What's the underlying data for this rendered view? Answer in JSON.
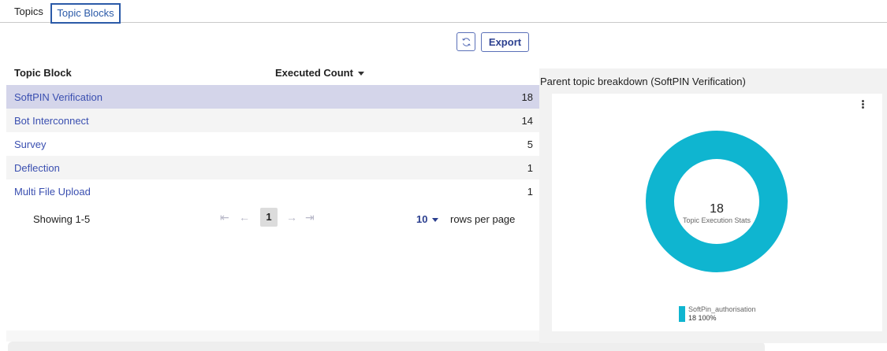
{
  "tabs": [
    {
      "label": "Topics"
    },
    {
      "label": "Topic Blocks"
    }
  ],
  "toolbar": {
    "refresh_icon": "refresh-icon",
    "export_label": "Export"
  },
  "table": {
    "columns": [
      "Topic Block",
      "Executed Count"
    ],
    "sort_column": "Executed Count",
    "rows": [
      {
        "name": "SoftPIN Verification",
        "count": "18"
      },
      {
        "name": "Bot Interconnect",
        "count": "14"
      },
      {
        "name": "Survey",
        "count": "5"
      },
      {
        "name": "Deflection",
        "count": "1"
      },
      {
        "name": "Multi File Upload",
        "count": "1"
      }
    ]
  },
  "pagination": {
    "showing": "Showing 1-5",
    "page": "1",
    "first_glyph": "⇤",
    "prev_glyph": "←",
    "next_glyph": "→",
    "last_glyph": "⇥",
    "rows_per_page_value": "10",
    "rows_per_page_label": "rows per page"
  },
  "panel": {
    "title": "Parent topic breakdown (SoftPIN Verification)",
    "center_value": "18",
    "center_label": "Topic Execution Stats",
    "legend": [
      {
        "name": "SoftPin_authorisation",
        "stats": "18  100%",
        "color": "#0fb5d0"
      }
    ]
  },
  "colors": {
    "accent": "#2b5aa8",
    "link": "#3a4fb0",
    "selected_row": "#d4d5ea",
    "donut": "#0fb5d0"
  }
}
